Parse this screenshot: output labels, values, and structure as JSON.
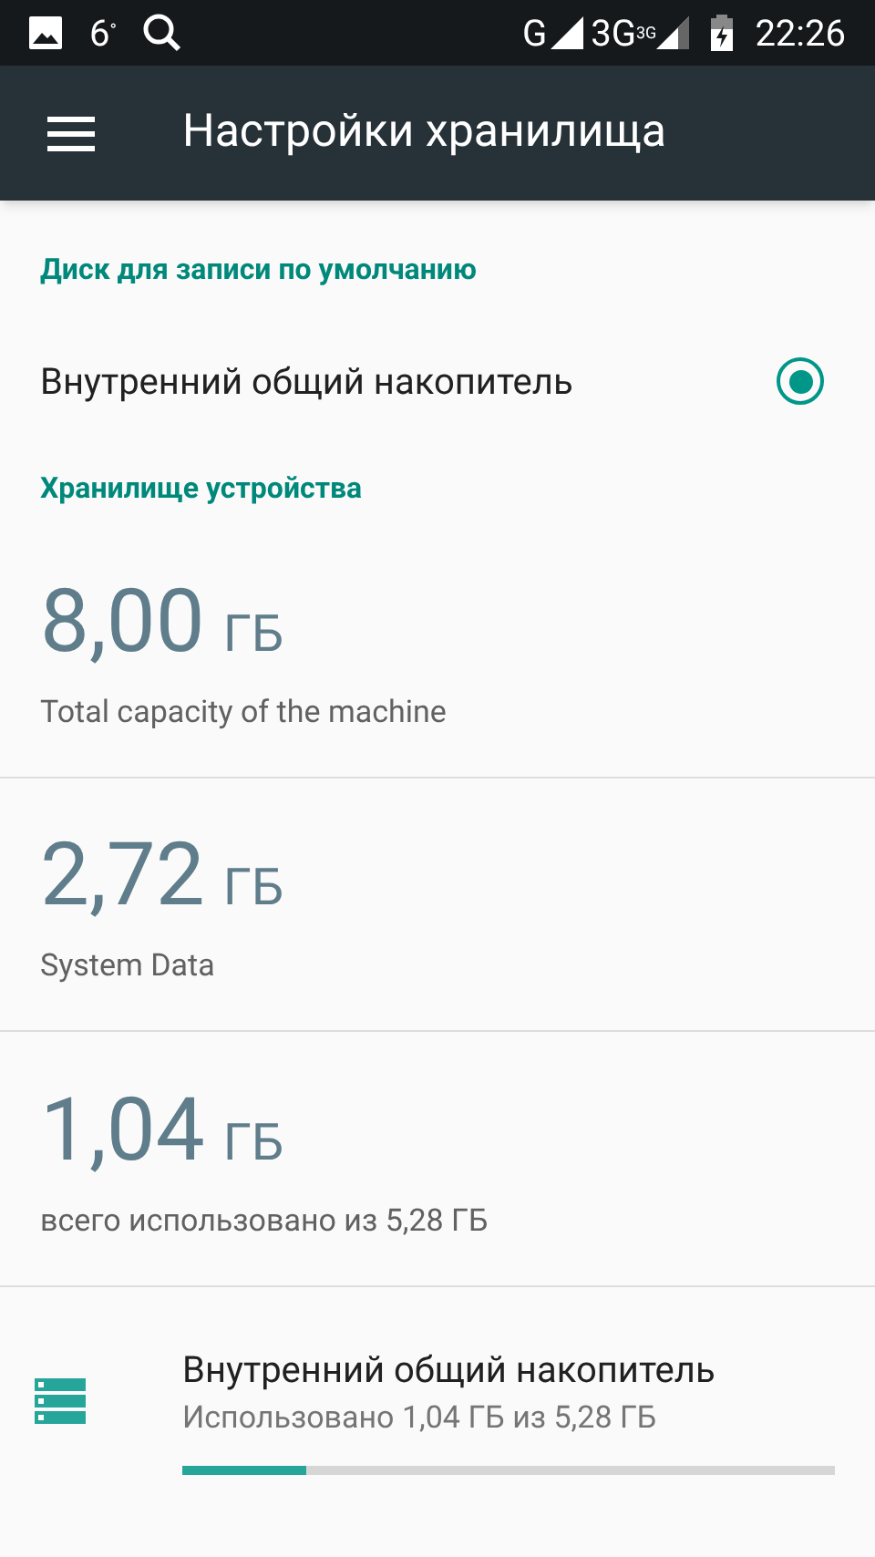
{
  "status_bar": {
    "weather": "6",
    "weather_unit": "°",
    "network_1": "G",
    "network_2": "3G",
    "network_2_sup": "3G",
    "time": "22:26"
  },
  "app_bar": {
    "title": "Настройки хранилища"
  },
  "default_disk": {
    "header": "Диск для записи по умолчанию",
    "options": [
      {
        "label": "Внутренний общий накопитель",
        "selected": true
      }
    ]
  },
  "device_storage": {
    "header": "Хранилище устройства",
    "stats": [
      {
        "value": "8,00",
        "unit": "ГБ",
        "label": "Total capacity of the machine"
      },
      {
        "value": "2,72",
        "unit": "ГБ",
        "label": "System Data"
      },
      {
        "value": "1,04",
        "unit": "ГБ",
        "label": "всего использовано из 5,28 ГБ"
      }
    ],
    "volumes": [
      {
        "title": "Внутренний общий накопитель",
        "summary": "Использовано 1,04 ГБ из 5,28 ГБ",
        "level": 0.19
      }
    ]
  }
}
